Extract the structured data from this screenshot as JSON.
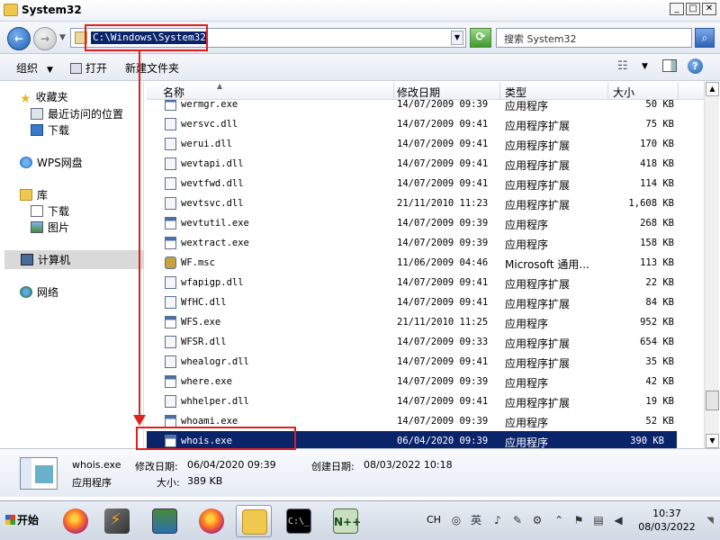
{
  "window": {
    "title": "System32"
  },
  "address": {
    "path": "C:\\Windows\\System32"
  },
  "search": {
    "placeholder": "搜索 System32"
  },
  "toolbar": {
    "organize": "组织",
    "open": "打开",
    "new_folder": "新建文件夹"
  },
  "sidebar": {
    "favorites": "收藏夹",
    "recent": "最近访问的位置",
    "downloads": "下载",
    "wps": "WPS网盘",
    "libraries": "库",
    "lib_downloads": "下载",
    "lib_pictures": "图片",
    "computer": "计算机",
    "network": "网络"
  },
  "columns": {
    "name": "名称",
    "modified": "修改日期",
    "type": "类型",
    "size": "大小"
  },
  "files": [
    {
      "name": "wermgr.exe",
      "date": "14/07/2009 09:39",
      "type": "应用程序",
      "size": "50 KB",
      "icon": "exe"
    },
    {
      "name": "wersvc.dll",
      "date": "14/07/2009 09:41",
      "type": "应用程序扩展",
      "size": "75 KB",
      "icon": "dll"
    },
    {
      "name": "werui.dll",
      "date": "14/07/2009 09:41",
      "type": "应用程序扩展",
      "size": "170 KB",
      "icon": "dll"
    },
    {
      "name": "wevtapi.dll",
      "date": "14/07/2009 09:41",
      "type": "应用程序扩展",
      "size": "418 KB",
      "icon": "dll"
    },
    {
      "name": "wevtfwd.dll",
      "date": "14/07/2009 09:41",
      "type": "应用程序扩展",
      "size": "114 KB",
      "icon": "dll"
    },
    {
      "name": "wevtsvc.dll",
      "date": "21/11/2010 11:23",
      "type": "应用程序扩展",
      "size": "1,608 KB",
      "icon": "dll"
    },
    {
      "name": "wevtutil.exe",
      "date": "14/07/2009 09:39",
      "type": "应用程序",
      "size": "268 KB",
      "icon": "exe"
    },
    {
      "name": "wextract.exe",
      "date": "14/07/2009 09:39",
      "type": "应用程序",
      "size": "158 KB",
      "icon": "exe"
    },
    {
      "name": "WF.msc",
      "date": "11/06/2009 04:46",
      "type": "Microsoft 通用...",
      "size": "113 KB",
      "icon": "msc"
    },
    {
      "name": "wfapigp.dll",
      "date": "14/07/2009 09:41",
      "type": "应用程序扩展",
      "size": "22 KB",
      "icon": "dll"
    },
    {
      "name": "WfHC.dll",
      "date": "14/07/2009 09:41",
      "type": "应用程序扩展",
      "size": "84 KB",
      "icon": "dll"
    },
    {
      "name": "WFS.exe",
      "date": "21/11/2010 11:25",
      "type": "应用程序",
      "size": "952 KB",
      "icon": "exe"
    },
    {
      "name": "WFSR.dll",
      "date": "14/07/2009 09:33",
      "type": "应用程序扩展",
      "size": "654 KB",
      "icon": "dll"
    },
    {
      "name": "whealogr.dll",
      "date": "14/07/2009 09:41",
      "type": "应用程序扩展",
      "size": "35 KB",
      "icon": "dll"
    },
    {
      "name": "where.exe",
      "date": "14/07/2009 09:39",
      "type": "应用程序",
      "size": "42 KB",
      "icon": "exe"
    },
    {
      "name": "whhelper.dll",
      "date": "14/07/2009 09:41",
      "type": "应用程序扩展",
      "size": "19 KB",
      "icon": "dll"
    },
    {
      "name": "whoami.exe",
      "date": "14/07/2009 09:39",
      "type": "应用程序",
      "size": "52 KB",
      "icon": "exe"
    },
    {
      "name": "whois.exe",
      "date": "06/04/2020 09:39",
      "type": "应用程序",
      "size": "390 KB",
      "icon": "exe",
      "selected": true
    }
  ],
  "details": {
    "name": "whois.exe",
    "modified_label": "修改日期:",
    "modified": "06/04/2020 09:39",
    "created_label": "创建日期:",
    "created": "08/03/2022 10:18",
    "type": "应用程序",
    "size_label": "大小:",
    "size": "389 KB"
  },
  "taskbar": {
    "start": "开始",
    "cmd_glyph": "C:\\_",
    "np_glyph": "N++",
    "lang": "CH",
    "time": "10:37",
    "date": "08/03/2022"
  },
  "colors": {
    "annotation": "#e02020",
    "selection": "#0a246a"
  }
}
